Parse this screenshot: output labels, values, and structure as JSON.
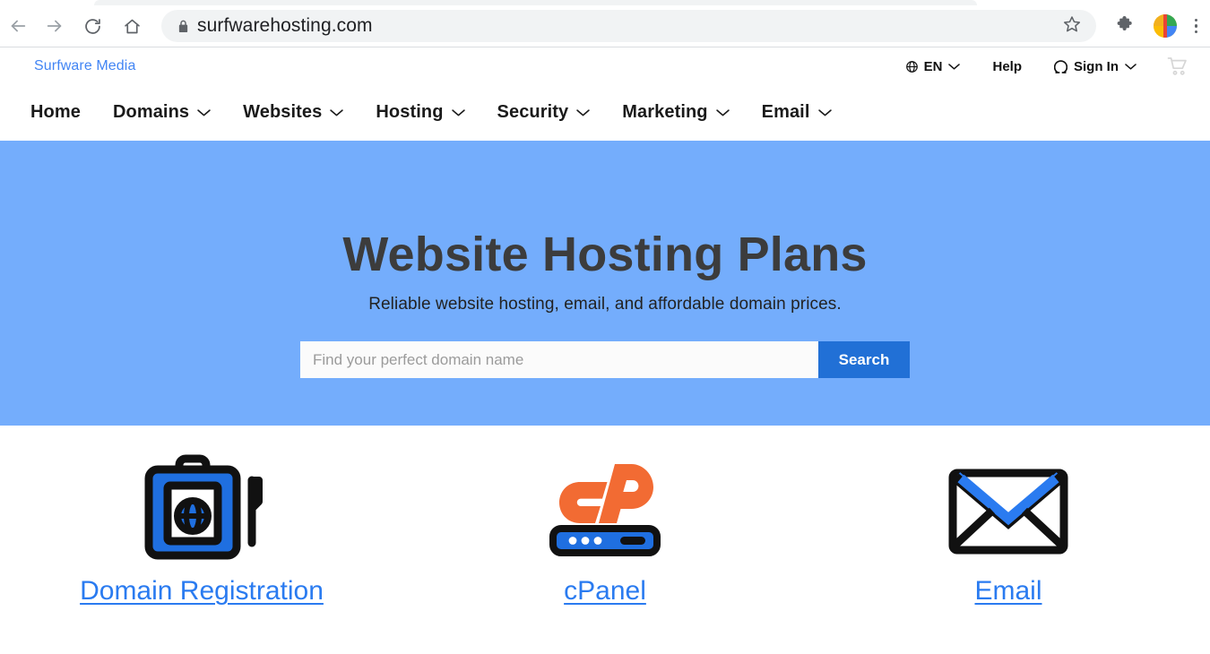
{
  "browser": {
    "url": "surfwarehosting.com",
    "back_icon": "back-arrow-icon",
    "forward_icon": "forward-arrow-icon",
    "reload_icon": "reload-icon",
    "home_icon": "home-icon",
    "lock_icon": "lock-icon",
    "star_icon": "star-icon",
    "extensions_icon": "puzzle-piece-icon",
    "profile_icon": "profile-avatar",
    "menu_icon": "three-dot-menu-icon"
  },
  "site": {
    "brand": "Surfware Media",
    "utility": {
      "language": "EN",
      "language_icon": "globe-icon",
      "help": "Help",
      "sign_in": "Sign In",
      "sign_in_icon": "person-icon",
      "cart_icon": "shopping-cart-icon",
      "chevron_icon": "chevron-down-icon"
    },
    "nav": [
      {
        "label": "Home",
        "has_chevron": false
      },
      {
        "label": "Domains",
        "has_chevron": true
      },
      {
        "label": "Websites",
        "has_chevron": true
      },
      {
        "label": "Hosting",
        "has_chevron": true
      },
      {
        "label": "Security",
        "has_chevron": true
      },
      {
        "label": "Marketing",
        "has_chevron": true
      },
      {
        "label": "Email",
        "has_chevron": true
      }
    ],
    "hero": {
      "title": "Website Hosting Plans",
      "subtitle": "Reliable website hosting, email, and affordable domain prices.",
      "search_placeholder": "Find your perfect domain name",
      "search_value": "",
      "search_button": "Search",
      "background_color": "#74adfc"
    },
    "features": [
      {
        "label": "Domain Registration",
        "icon": "domain-registration-icon"
      },
      {
        "label": "cPanel",
        "icon": "cpanel-logo-icon"
      },
      {
        "label": "Email",
        "icon": "envelope-icon"
      }
    ],
    "colors": {
      "brand_blue": "#4285f4",
      "link_blue": "#2a7bf0",
      "button_blue": "#2170d6",
      "hero_blue": "#74adfc",
      "cpanel_orange": "#f26b33"
    }
  }
}
